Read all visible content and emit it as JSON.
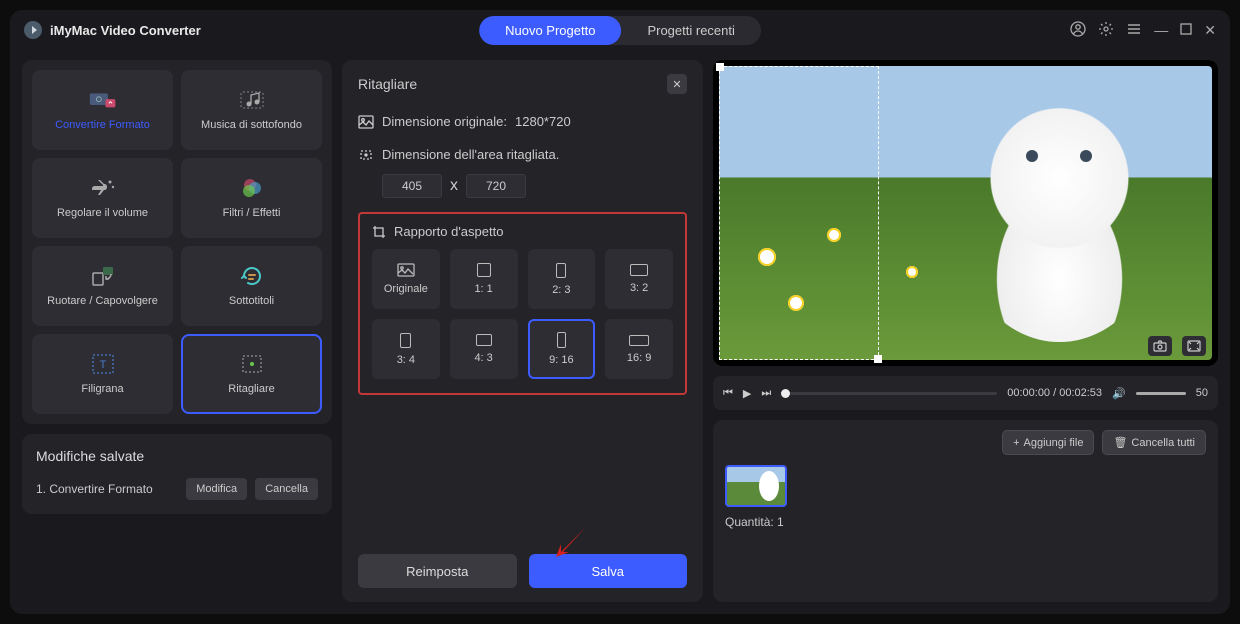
{
  "app": {
    "title": "iMyMac Video Converter"
  },
  "tabs": {
    "new": "Nuovo Progetto",
    "recent": "Progetti recenti"
  },
  "tools": [
    {
      "label": "Convertire Formato"
    },
    {
      "label": "Musica di sottofondo"
    },
    {
      "label": "Regolare il volume"
    },
    {
      "label": "Filtri / Effetti"
    },
    {
      "label": "Ruotare / Capovolgere"
    },
    {
      "label": "Sottotitoli"
    },
    {
      "label": "Filigrana"
    },
    {
      "label": "Ritagliare"
    }
  ],
  "saved": {
    "title": "Modifiche salvate",
    "item": "1.  Convertire Formato",
    "edit": "Modifica",
    "delete": "Cancella"
  },
  "crop": {
    "title": "Ritagliare",
    "orig_label": "Dimensione originale:",
    "orig_value": "1280*720",
    "area_label": "Dimensione dell'area ritagliata.",
    "w": "405",
    "h": "720",
    "x": "x",
    "aspect_title": "Rapporto d'aspetto",
    "ratios": [
      "Originale",
      "1:  1",
      "2:  3",
      "3:  2",
      "3:  4",
      "4:  3",
      "9:  16",
      "16:  9"
    ],
    "reset": "Reimposta",
    "save": "Salva"
  },
  "player": {
    "time": "00:00:00 / 00:02:53",
    "volume": "50"
  },
  "files": {
    "add": "Aggiungi file",
    "clear": "Cancella tutti",
    "qty_label": "Quantità:",
    "qty": "1"
  }
}
